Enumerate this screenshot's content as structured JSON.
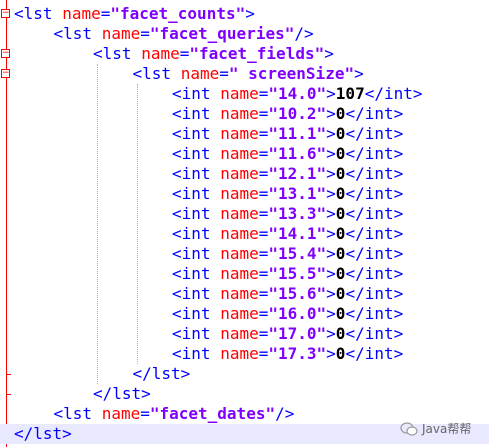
{
  "editor": {
    "fold_box_symbol": "−",
    "lines": [
      {
        "indent": 0,
        "open": "<",
        "tag": "lst",
        "attr": "name",
        "eq": "=",
        "value": "\"facet_counts\"",
        "close": ">",
        "content": "",
        "end_tag": ""
      },
      {
        "indent": 1,
        "open": "<",
        "tag": "lst",
        "attr": "name",
        "eq": "=",
        "value": "\"facet_queries\"",
        "close": "/>",
        "content": "",
        "end_tag": ""
      },
      {
        "indent": 2,
        "open": "<",
        "tag": "lst",
        "attr": "name",
        "eq": "=",
        "value": "\"facet_fields\"",
        "close": ">",
        "content": "",
        "end_tag": ""
      },
      {
        "indent": 3,
        "open": "<",
        "tag": "lst",
        "attr": "name",
        "eq": "=",
        "value": "\" screenSize\"",
        "close": ">",
        "content": "",
        "end_tag": ""
      },
      {
        "indent": 4,
        "open": "<",
        "tag": "int",
        "attr": "name",
        "eq": "=",
        "value": "\"14.0\"",
        "close": ">",
        "content": "107",
        "end_tag": "</int>"
      },
      {
        "indent": 4,
        "open": "<",
        "tag": "int",
        "attr": "name",
        "eq": "=",
        "value": "\"10.2\"",
        "close": ">",
        "content": "0",
        "end_tag": "</int>"
      },
      {
        "indent": 4,
        "open": "<",
        "tag": "int",
        "attr": "name",
        "eq": "=",
        "value": "\"11.1\"",
        "close": ">",
        "content": "0",
        "end_tag": "</int>"
      },
      {
        "indent": 4,
        "open": "<",
        "tag": "int",
        "attr": "name",
        "eq": "=",
        "value": "\"11.6\"",
        "close": ">",
        "content": "0",
        "end_tag": "</int>"
      },
      {
        "indent": 4,
        "open": "<",
        "tag": "int",
        "attr": "name",
        "eq": "=",
        "value": "\"12.1\"",
        "close": ">",
        "content": "0",
        "end_tag": "</int>"
      },
      {
        "indent": 4,
        "open": "<",
        "tag": "int",
        "attr": "name",
        "eq": "=",
        "value": "\"13.1\"",
        "close": ">",
        "content": "0",
        "end_tag": "</int>"
      },
      {
        "indent": 4,
        "open": "<",
        "tag": "int",
        "attr": "name",
        "eq": "=",
        "value": "\"13.3\"",
        "close": ">",
        "content": "0",
        "end_tag": "</int>"
      },
      {
        "indent": 4,
        "open": "<",
        "tag": "int",
        "attr": "name",
        "eq": "=",
        "value": "\"14.1\"",
        "close": ">",
        "content": "0",
        "end_tag": "</int>"
      },
      {
        "indent": 4,
        "open": "<",
        "tag": "int",
        "attr": "name",
        "eq": "=",
        "value": "\"15.4\"",
        "close": ">",
        "content": "0",
        "end_tag": "</int>"
      },
      {
        "indent": 4,
        "open": "<",
        "tag": "int",
        "attr": "name",
        "eq": "=",
        "value": "\"15.5\"",
        "close": ">",
        "content": "0",
        "end_tag": "</int>"
      },
      {
        "indent": 4,
        "open": "<",
        "tag": "int",
        "attr": "name",
        "eq": "=",
        "value": "\"15.6\"",
        "close": ">",
        "content": "0",
        "end_tag": "</int>"
      },
      {
        "indent": 4,
        "open": "<",
        "tag": "int",
        "attr": "name",
        "eq": "=",
        "value": "\"16.0\"",
        "close": ">",
        "content": "0",
        "end_tag": "</int>"
      },
      {
        "indent": 4,
        "open": "<",
        "tag": "int",
        "attr": "name",
        "eq": "=",
        "value": "\"17.0\"",
        "close": ">",
        "content": "0",
        "end_tag": "</int>"
      },
      {
        "indent": 4,
        "open": "<",
        "tag": "int",
        "attr": "name",
        "eq": "=",
        "value": "\"17.3\"",
        "close": ">",
        "content": "0",
        "end_tag": "</int>"
      },
      {
        "indent": 3,
        "open": "</",
        "tag": "lst",
        "attr": "",
        "eq": "",
        "value": "",
        "close": ">",
        "content": "",
        "end_tag": ""
      },
      {
        "indent": 2,
        "open": "</",
        "tag": "lst",
        "attr": "",
        "eq": "",
        "value": "",
        "close": ">",
        "content": "",
        "end_tag": ""
      },
      {
        "indent": 1,
        "open": "<",
        "tag": "lst",
        "attr": "name",
        "eq": "=",
        "value": "\"facet_dates\"",
        "close": "/>",
        "content": "",
        "end_tag": ""
      },
      {
        "indent": 0,
        "open": "</",
        "tag": "lst",
        "attr": "",
        "eq": "",
        "value": "",
        "close": ">",
        "content": "",
        "end_tag": ""
      }
    ]
  },
  "watermark": {
    "text": "Java帮帮",
    "icon": "wechat-icon"
  }
}
